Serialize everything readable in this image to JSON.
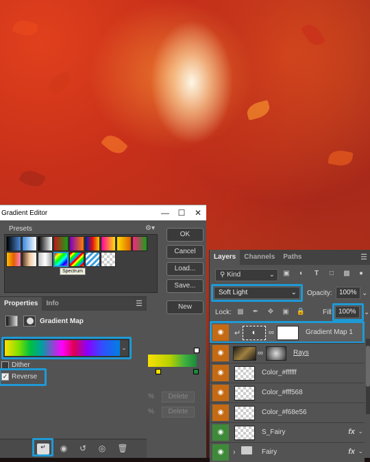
{
  "gradient_editor": {
    "title": "Gradient Editor",
    "presets_label": "Presets",
    "tooltip": "Spectrum",
    "buttons": {
      "ok": "OK",
      "cancel": "Cancel",
      "load": "Load...",
      "save": "Save...",
      "new": "New"
    },
    "delete_label": "Delete",
    "pct": "%"
  },
  "properties": {
    "tabs": [
      "Properties",
      "Info"
    ],
    "title": "Gradient Map",
    "dither_label": "Dither",
    "dither_checked": false,
    "reverse_label": "Reverse",
    "reverse_checked": true
  },
  "layers": {
    "tabs": [
      "Layers",
      "Channels",
      "Paths"
    ],
    "kind_label": "Kind",
    "blend_mode": "Soft Light",
    "opacity_label": "Opacity:",
    "opacity_value": "100%",
    "lock_label": "Lock:",
    "fill_label": "Fill:",
    "fill_value": "100%",
    "items": [
      {
        "name": "Gradient Map 1"
      },
      {
        "name": "Rays"
      },
      {
        "name": "Color_#ffffff"
      },
      {
        "name": "Color_#fff568"
      },
      {
        "name": "Color_#f68e56"
      },
      {
        "name": "S_Fairy",
        "fx": "fx"
      },
      {
        "name": "Fairy",
        "fx": "fx"
      }
    ]
  }
}
